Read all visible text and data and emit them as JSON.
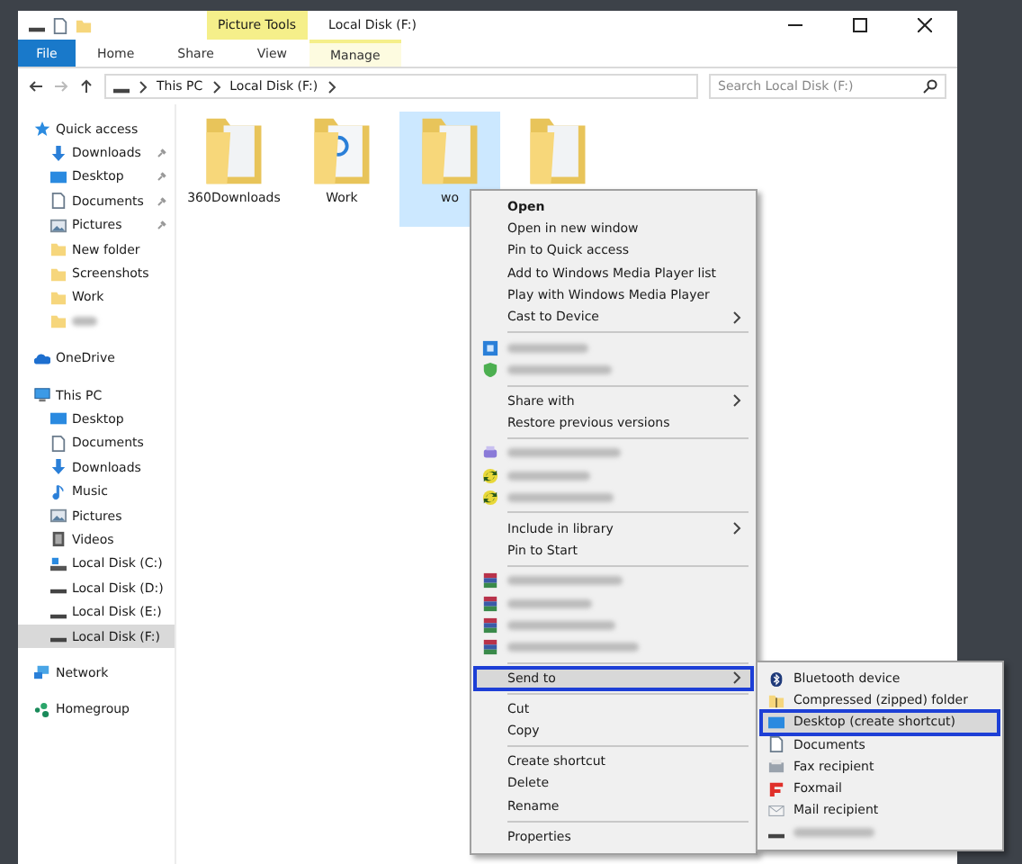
{
  "window": {
    "title": "Local Disk (F:)",
    "context_group": "Picture Tools"
  },
  "ribbon_tabs": [
    {
      "label": "File",
      "kind": "file"
    },
    {
      "label": "Home",
      "kind": "tab"
    },
    {
      "label": "Share",
      "kind": "tab"
    },
    {
      "label": "View",
      "kind": "tab"
    },
    {
      "label": "Manage",
      "kind": "context"
    }
  ],
  "address": {
    "breadcrumbs": [
      "This PC",
      "Local Disk (F:)"
    ],
    "search": {
      "placeholder": "Search Local Disk (F:)"
    }
  },
  "sidebar": [
    {
      "label": "Quick access",
      "kind": "star",
      "children": [
        {
          "label": "Downloads",
          "kind": "download",
          "pinned": true
        },
        {
          "label": "Desktop",
          "kind": "desktop",
          "pinned": true
        },
        {
          "label": "Documents",
          "kind": "document",
          "pinned": true
        },
        {
          "label": "Pictures",
          "kind": "pictures",
          "pinned": true
        },
        {
          "label": "New folder",
          "kind": "folder",
          "pinned": false
        },
        {
          "label": "Screenshots",
          "kind": "folder",
          "pinned": false
        },
        {
          "label": "Work",
          "kind": "folder",
          "pinned": false
        },
        {
          "kind": "folder"
        }
      ]
    },
    {
      "label": "OneDrive",
      "kind": "cloud"
    },
    {
      "label": "This PC",
      "kind": "pc",
      "children": [
        {
          "label": "Desktop",
          "kind": "desktop",
          "selected": false
        },
        {
          "label": "Documents",
          "kind": "document",
          "selected": false
        },
        {
          "label": "Downloads",
          "kind": "download",
          "selected": false
        },
        {
          "label": "Music",
          "kind": "music",
          "selected": false
        },
        {
          "label": "Pictures",
          "kind": "pictures",
          "selected": false
        },
        {
          "label": "Videos",
          "kind": "video",
          "selected": false
        },
        {
          "label": "Local Disk (C:)",
          "kind": "system-drive",
          "selected": false
        },
        {
          "label": "Local Disk (D:)",
          "kind": "drive",
          "selected": false
        },
        {
          "label": "Local Disk (E:)",
          "kind": "drive",
          "selected": false
        },
        {
          "label": "Local Disk (F:)",
          "kind": "drive",
          "selected": true
        }
      ]
    },
    {
      "label": "Network",
      "kind": "network"
    },
    {
      "label": "Homegroup",
      "kind": "homegroup"
    }
  ],
  "files": [
    {
      "label": "360Downloads",
      "kind": "folder",
      "selected": false
    },
    {
      "label": "Work",
      "kind": "media-folder",
      "selected": false
    },
    {
      "label": "wo",
      "kind": "folder",
      "selected": true
    },
    {
      "kind": "folder",
      "selected": false
    }
  ],
  "context_menu": [
    {
      "kind": "item",
      "label": "Open",
      "default": true
    },
    {
      "kind": "item",
      "label": "Open in new window"
    },
    {
      "kind": "item",
      "label": "Pin to Quick access"
    },
    {
      "kind": "item",
      "label": "Add to Windows Media Player list"
    },
    {
      "kind": "item",
      "label": "Play with Windows Media Player"
    },
    {
      "kind": "item",
      "label": "Cast to Device",
      "submenu": true
    },
    {
      "kind": "separator"
    },
    {
      "kind": "app"
    },
    {
      "kind": "shield"
    },
    {
      "kind": "separator"
    },
    {
      "kind": "item",
      "label": "Share with",
      "submenu": true
    },
    {
      "kind": "item",
      "label": "Restore previous versions"
    },
    {
      "kind": "separator"
    },
    {
      "kind": "printer"
    },
    {
      "kind": "sync"
    },
    {
      "kind": "sync"
    },
    {
      "kind": "separator"
    },
    {
      "kind": "item",
      "label": "Include in library",
      "submenu": true
    },
    {
      "kind": "item",
      "label": "Pin to Start"
    },
    {
      "kind": "separator"
    },
    {
      "kind": "archive"
    },
    {
      "kind": "archive"
    },
    {
      "kind": "archive"
    },
    {
      "kind": "archive"
    },
    {
      "kind": "separator"
    },
    {
      "kind": "item",
      "label": "Send to",
      "submenu": true,
      "selected": true
    },
    {
      "kind": "separator"
    },
    {
      "kind": "item",
      "label": "Cut"
    },
    {
      "kind": "item",
      "label": "Copy"
    },
    {
      "kind": "separator"
    },
    {
      "kind": "item",
      "label": "Create shortcut"
    },
    {
      "kind": "item",
      "label": "Delete"
    },
    {
      "kind": "item",
      "label": "Rename"
    },
    {
      "kind": "separator"
    },
    {
      "kind": "item",
      "label": "Properties"
    }
  ],
  "send_to_menu": [
    {
      "label": "Bluetooth device",
      "kind": "bluetooth",
      "selected": false
    },
    {
      "label": "Compressed (zipped) folder",
      "kind": "zip",
      "selected": false
    },
    {
      "label": "Desktop (create shortcut)",
      "kind": "desktop",
      "selected": true
    },
    {
      "label": "Documents",
      "kind": "document",
      "selected": false
    },
    {
      "label": "Fax recipient",
      "kind": "fax",
      "selected": false
    },
    {
      "label": "Foxmail",
      "kind": "foxmail",
      "selected": false
    },
    {
      "label": "Mail recipient",
      "kind": "mail",
      "selected": false
    },
    {
      "kind": "drive",
      "selected": false
    }
  ]
}
